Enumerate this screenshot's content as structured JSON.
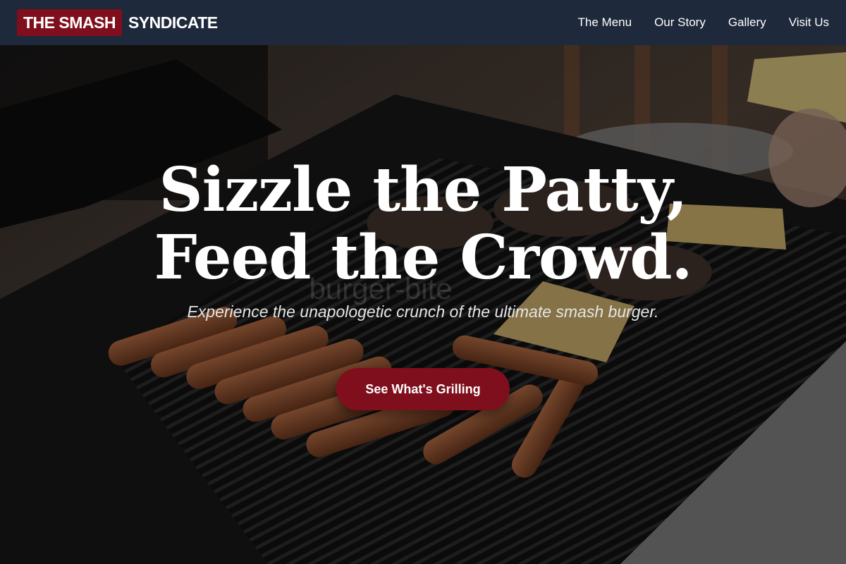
{
  "nav": {
    "brand_highlight": "THE SMASH",
    "brand_rest": "SYNDICATE",
    "links": [
      {
        "label": "The Menu"
      },
      {
        "label": "Our Story"
      },
      {
        "label": "Gallery"
      },
      {
        "label": "Visit Us"
      }
    ]
  },
  "hero": {
    "title_line1": "Sizzle the Patty,",
    "title_line2": "Feed the Crowd.",
    "ghost_text": "burger-bite",
    "subtitle": "Experience the unapologetic crunch of the ultimate smash burger.",
    "cta_label": "See What's Grilling",
    "background_image": "grill-with-burger-patties-and-hot-dogs"
  },
  "colors": {
    "nav_background": "#1e293b",
    "accent": "#7f0f1c",
    "text": "#ffffff"
  }
}
